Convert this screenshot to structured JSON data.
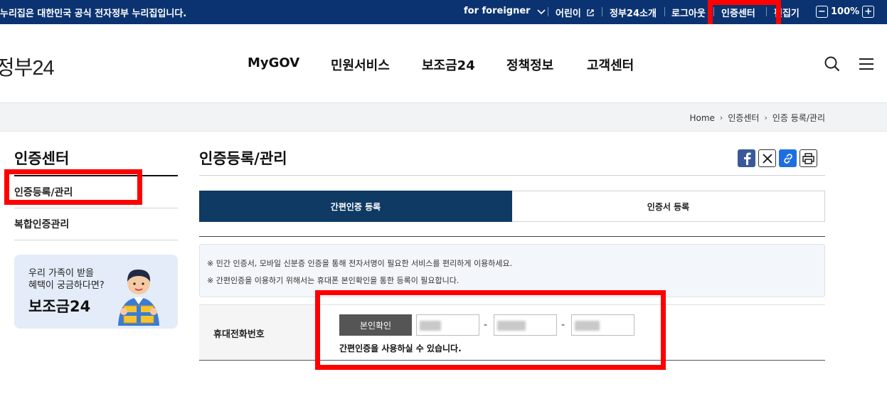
{
  "topbar": {
    "notice": "누리집은 대한민국 공식 전자정부 누리집입니다.",
    "foreigner": "for foreigner",
    "kids": "어린이",
    "about": "정부24소개",
    "logout": "로그아웃",
    "cert_center": "인증센터",
    "edit": "편집기",
    "zoom": "100%",
    "zoom_minus": "−",
    "zoom_plus": "+"
  },
  "header": {
    "logo": "정부24",
    "nav": [
      "MyGOV",
      "민원서비스",
      "보조금24",
      "정책정보",
      "고객센터"
    ]
  },
  "breadcrumb": [
    "Home",
    "인증센터",
    "인증 등록/관리"
  ],
  "lnb": {
    "title": "인증센터",
    "items": [
      "인증등록/관리",
      "복합인증관리"
    ],
    "banner_line1": "우리 가족이 받을",
    "banner_line2": "혜택이 궁금하다면?",
    "banner_title": "보조금24"
  },
  "content": {
    "title": "인증등록/관리",
    "tabs": [
      "간편인증 등록",
      "인증서 등록"
    ],
    "notices": [
      "※ 민간 인증서, 모바일 신분증 인증을 통해 전자서명이 필요한 서비스를 편리하게 이용하세요.",
      "※ 간편인증을 이용하기 위해서는 휴대폰 본인확인을 통한 등록이 필요합니다."
    ],
    "form_label": "휴대전화번호",
    "verify_button": "본인확인",
    "dash": "-",
    "message": "간편인증을 사용하실 수 있습니다."
  },
  "colors": {
    "topbar": "#0b3371",
    "active_tab": "#0f3a63",
    "highlight": "#ff0000"
  }
}
